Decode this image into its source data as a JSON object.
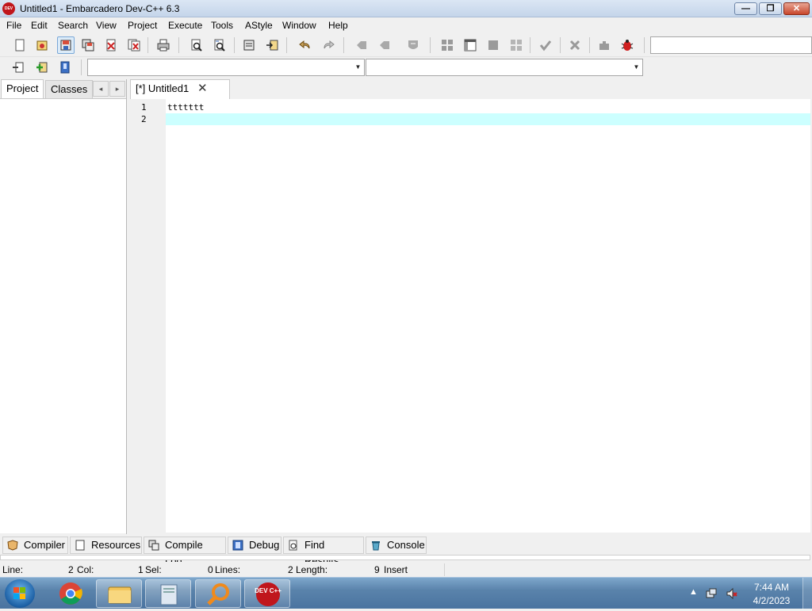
{
  "window": {
    "title": "Untitled1 - Embarcadero Dev-C++ 6.3",
    "app_icon_text": "DEV C++",
    "min_glyph": "—",
    "max_glyph": "❐",
    "close_glyph": "✕"
  },
  "menu": [
    "File",
    "Edit",
    "Search",
    "View",
    "Project",
    "Execute",
    "Tools",
    "AStyle",
    "Window",
    "Help"
  ],
  "toolbar": {
    "icons": [
      "new-file-icon",
      "open-project-icon",
      "save-icon",
      "save-all-icon",
      "close-file-icon",
      "close-all-icon",
      "print-icon",
      "find-icon",
      "replace-icon",
      "compile-icon",
      "run-icon",
      "undo-icon",
      "redo-icon",
      "indent-icon",
      "unindent-icon",
      "comment-icon",
      "grid-icon",
      "layout-icon",
      "fullscreen-icon",
      "tile-icon",
      "check-icon",
      "delete-icon",
      "puzzle-icon",
      "bug-icon"
    ],
    "row2_icons": [
      "goto-icon",
      "add-file-icon",
      "bookmark-icon"
    ],
    "combo_class": "",
    "combo_function": ""
  },
  "left_panel": {
    "tabs": [
      "Project",
      "Classes"
    ],
    "active_tab": "Project",
    "nav_prev": "◂",
    "nav_next": "▸"
  },
  "editor": {
    "tabs": [
      {
        "label": "[*] Untitled1",
        "close": "✕"
      }
    ],
    "line_numbers": [
      "1",
      "2"
    ],
    "lines": [
      "ttttttt",
      ""
    ],
    "current_line": 2,
    "current_line_color": "#ccffff"
  },
  "bottom_tabs": [
    {
      "label": "Compiler",
      "icon": "compiler-icon"
    },
    {
      "label": "Resources",
      "icon": "resources-icon"
    },
    {
      "label": "Compile Log",
      "icon": "compile-log-icon"
    },
    {
      "label": "Debug",
      "icon": "debug-icon"
    },
    {
      "label": "Find Results",
      "icon": "find-results-icon"
    },
    {
      "label": "Console",
      "icon": "console-icon"
    }
  ],
  "status": {
    "line_label": "Line:",
    "line_val": "2",
    "col_label": "Col:",
    "col_val": "1",
    "sel_label": "Sel:",
    "sel_val": "0",
    "lines_label": "Lines:",
    "lines_val": "2",
    "length_label": "Length:",
    "length_val": "9",
    "mode": "Insert"
  },
  "taskbar": {
    "apps": [
      "chrome-icon",
      "explorer-icon",
      "notepad-icon",
      "search-tool-icon",
      "devcpp-icon"
    ],
    "devcpp_label": "DEV C++",
    "time": "7:44 AM",
    "date": "4/2/2023",
    "tray_arrow": "▲"
  }
}
